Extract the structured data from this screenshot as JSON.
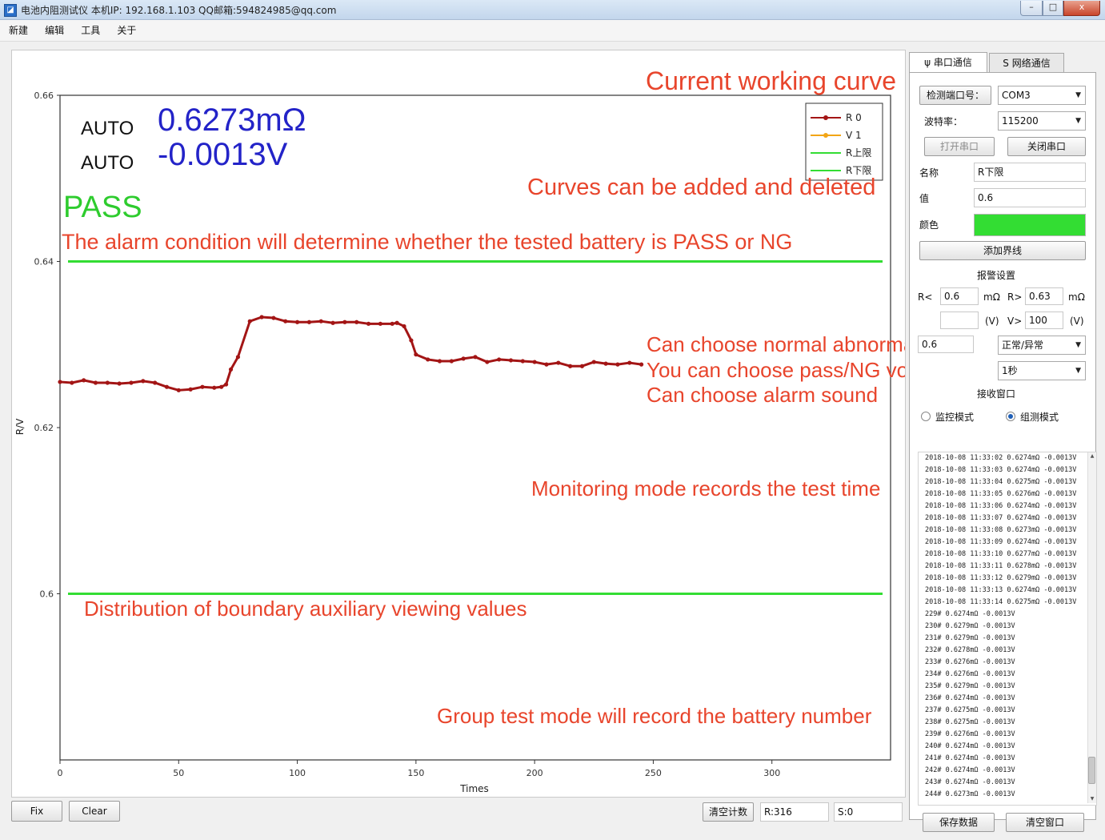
{
  "window": {
    "title": "电池内阻测试仪  本机IP: 192.168.1.103  QQ邮箱:594824985@qq.com",
    "min_label": "–",
    "max_label": "□",
    "close_label": "x"
  },
  "menu": [
    "新建",
    "编辑",
    "工具",
    "关于"
  ],
  "readout": {
    "mode1": "AUTO",
    "value1": "0.6273mΩ",
    "mode2": "AUTO",
    "value2": "-0.0013V",
    "status": "PASS"
  },
  "annotations": {
    "current_curve": "Current working curve",
    "curves_added": "Curves can be added and deleted",
    "alarm_condition": "The alarm condition will determine whether the tested battery is PASS or NG",
    "normal_voice": "Can choose normal abnormal voice",
    "pass_ng_voice": "You can choose pass/NG voice",
    "alarm_sound": "Can choose alarm sound",
    "monitoring_mode": "Monitoring mode records the test time",
    "boundary_values": "Distribution of boundary auxiliary viewing values",
    "group_test": "Group test mode will record the battery number"
  },
  "chart_data": {
    "type": "line",
    "xlabel": "Times",
    "ylabel": "R/V",
    "xlim": [
      0,
      350
    ],
    "ylim": [
      0.58,
      0.66
    ],
    "xticks": [
      0,
      50,
      100,
      150,
      200,
      250,
      300
    ],
    "yticks": [
      0.6,
      0.62,
      0.64,
      0.66
    ],
    "ytick_labels": [
      "0.6",
      "0.62",
      "0.64",
      "0.66"
    ],
    "legend_position": "top-right",
    "series": [
      {
        "name": "R 0",
        "color": "#a31515",
        "x": [
          0,
          5,
          10,
          15,
          20,
          25,
          30,
          35,
          40,
          45,
          50,
          55,
          60,
          65,
          68,
          70,
          72,
          75,
          80,
          85,
          90,
          95,
          100,
          105,
          110,
          115,
          120,
          125,
          130,
          135,
          140,
          142,
          145,
          148,
          150,
          155,
          160,
          165,
          170,
          175,
          180,
          185,
          190,
          195,
          200,
          205,
          210,
          215,
          220,
          225,
          230,
          235,
          240,
          245
        ],
        "values": [
          0.6255,
          0.6254,
          0.6257,
          0.6254,
          0.6254,
          0.6253,
          0.6254,
          0.6256,
          0.6254,
          0.6249,
          0.6245,
          0.6246,
          0.6249,
          0.6248,
          0.6249,
          0.6252,
          0.627,
          0.6285,
          0.6328,
          0.6333,
          0.6332,
          0.6328,
          0.6327,
          0.6327,
          0.6328,
          0.6326,
          0.6327,
          0.6327,
          0.6325,
          0.6325,
          0.6325,
          0.6326,
          0.6322,
          0.6305,
          0.6288,
          0.6282,
          0.628,
          0.628,
          0.6283,
          0.6285,
          0.6279,
          0.6282,
          0.6281,
          0.628,
          0.6279,
          0.6276,
          0.6278,
          0.6274,
          0.6274,
          0.6279,
          0.6277,
          0.6276,
          0.6278,
          0.6276
        ]
      },
      {
        "name": "V 1",
        "color": "#f2a516",
        "x": [],
        "values": []
      },
      {
        "name": "R上限",
        "color": "#33dd33",
        "x": [
          0,
          350
        ],
        "values": [
          0.64,
          0.64
        ]
      },
      {
        "name": "R下限",
        "color": "#33dd33",
        "x": [
          0,
          350
        ],
        "values": [
          0.6,
          0.6
        ]
      }
    ]
  },
  "bottom": {
    "fix": "Fix",
    "clear": "Clear",
    "clear_count": "清空计数",
    "r_count": "R:316",
    "s_count": "S:0"
  },
  "panel": {
    "tab_serial": "串口通信",
    "tab_network": "网络通信",
    "port_label": "检测端口号：",
    "port_value": "COM3",
    "baud_label": "波特率：",
    "baud_value": "115200",
    "open_port": "打开串口",
    "close_port": "关闭串口",
    "name_label": "名称",
    "name_value": "R下限",
    "value_label": "值",
    "value_value": "0.6",
    "color_label": "颜色",
    "color_value": "#33dd33",
    "add_boundary": "添加界线",
    "alarm_settings": "报警设置",
    "r_lt_label": "R<",
    "r_lt_value": "0.6",
    "r_lt_unit": "mΩ",
    "r_gt_label": "R>",
    "r_gt_value": "0.63",
    "r_gt_unit": "mΩ",
    "v_lt_unit": "(V)",
    "v_gt_label": "V>",
    "v_gt_value": "100",
    "v_gt_unit": "(V)",
    "voice_mode": "正常/异常",
    "voice_value": "0.6",
    "sound_value": "1秒",
    "receive_window": "接收窗口",
    "monitor_mode": "监控模式",
    "detect_mode": "组测模式",
    "save_data": "保存数据",
    "clear_window": "清空窗口"
  },
  "log": [
    "2018-10-08 11:33:02 0.6274mΩ -0.0013V",
    "2018-10-08 11:33:03 0.6274mΩ -0.0013V",
    "2018-10-08 11:33:04 0.6275mΩ -0.0013V",
    "2018-10-08 11:33:05 0.6276mΩ -0.0013V",
    "2018-10-08 11:33:06 0.6274mΩ -0.0013V",
    "2018-10-08 11:33:07 0.6274mΩ -0.0013V",
    "2018-10-08 11:33:08 0.6273mΩ -0.0013V",
    "2018-10-08 11:33:09 0.6274mΩ -0.0013V",
    "2018-10-08 11:33:10 0.6277mΩ -0.0013V",
    "2018-10-08 11:33:11 0.6278mΩ -0.0013V",
    "2018-10-08 11:33:12 0.6279mΩ -0.0013V",
    "2018-10-08 11:33:13 0.6274mΩ -0.0013V",
    "2018-10-08 11:33:14 0.6275mΩ -0.0013V",
    "229# 0.6274mΩ -0.0013V",
    "230# 0.6279mΩ -0.0013V",
    "231# 0.6279mΩ -0.0013V",
    "232# 0.6278mΩ -0.0013V",
    "233# 0.6276mΩ -0.0013V",
    "234# 0.6276mΩ -0.0013V",
    "235# 0.6279mΩ -0.0013V",
    "236# 0.6274mΩ -0.0013V",
    "237# 0.6275mΩ -0.0013V",
    "238# 0.6275mΩ -0.0013V",
    "239# 0.6276mΩ -0.0013V",
    "240# 0.6274mΩ -0.0013V",
    "241# 0.6274mΩ -0.0013V",
    "242# 0.6274mΩ -0.0013V",
    "243# 0.6274mΩ -0.0013V",
    "244# 0.6273mΩ -0.0013V"
  ]
}
